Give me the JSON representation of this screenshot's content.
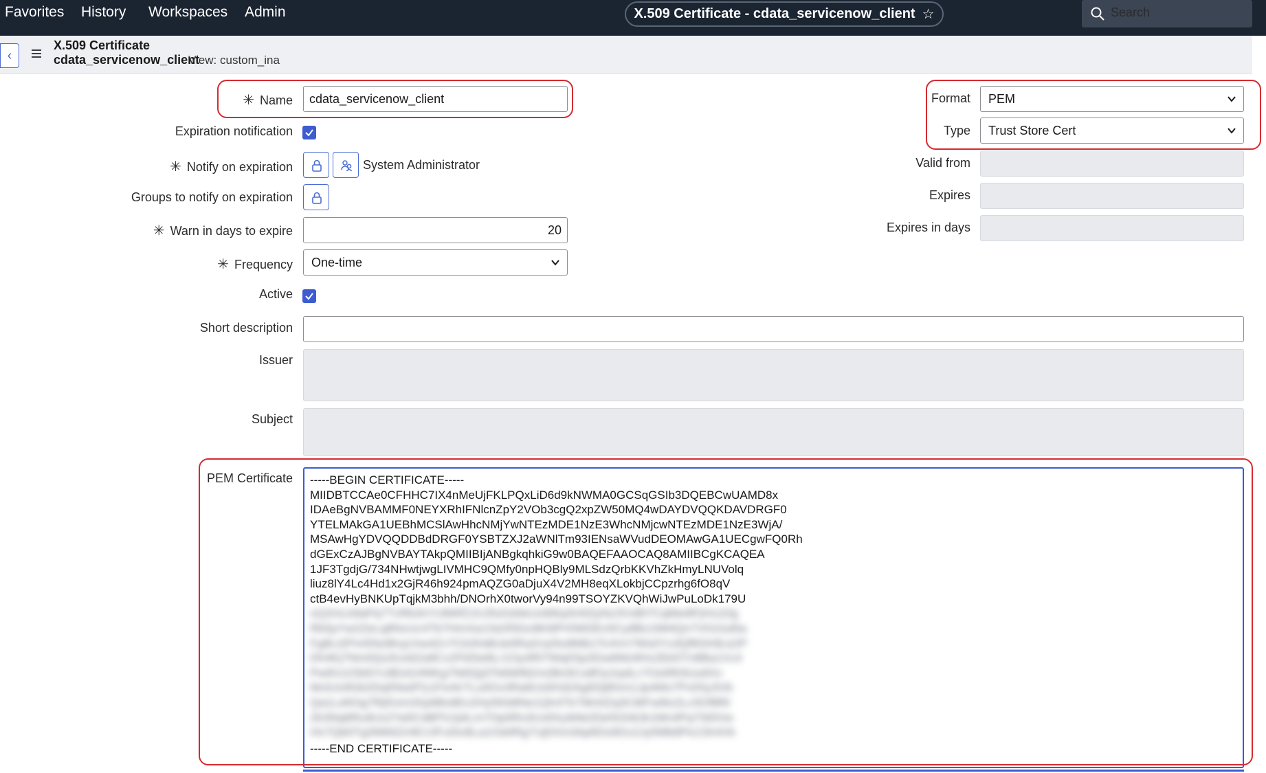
{
  "nav": {
    "items": [
      "Favorites",
      "History",
      "Workspaces",
      "Admin"
    ],
    "title": "X.509 Certificate - cdata_servicenow_client",
    "search_label": "Search"
  },
  "record": {
    "type": "X.509 Certificate",
    "name": "cdata_servicenow_client",
    "view": "View: custom_ina"
  },
  "form": {
    "name_label": "Name",
    "name_value": "cdata_servicenow_client",
    "expiration_notification_label": "Expiration notification",
    "expiration_notification_checked": true,
    "notify_on_expiration_label": "Notify on expiration",
    "notify_on_expiration_value": "System Administrator",
    "groups_to_notify_label": "Groups to notify on expiration",
    "warn_days_label": "Warn in days to expire",
    "warn_days_value": "20",
    "frequency_label": "Frequency",
    "frequency_value": "One-time",
    "active_label": "Active",
    "active_checked": true,
    "short_description_label": "Short description",
    "short_description_value": "",
    "issuer_label": "Issuer",
    "subject_label": "Subject",
    "pem_label": "PEM Certificate",
    "format_label": "Format",
    "format_value": "PEM",
    "type_label": "Type",
    "type_value": "Trust Store Cert",
    "valid_from_label": "Valid from",
    "expires_label": "Expires",
    "expires_in_days_label": "Expires in days"
  },
  "pem": {
    "lines": [
      "-----BEGIN CERTIFICATE-----",
      "MIIDBTCCAe0CFHHC7IX4nMeUjFKLPQxLiD6d9kNWMA0GCSqGSIb3DQEBCwUAMD8x",
      "IDAeBgNVBAMMF0NEYXRhIFNlcnZpY2VOb3cgQ2xpZW50MQ4wDAYDVQQKDAVDRGF0",
      "YTELMAkGA1UEBhMCSlAwHhcNMjYwNTEzMDE1NzE3WhcNMjcwNTEzMDE1NzE3WjA/",
      "MSAwHgYDVQQDDBdDRGF0YSBTZXJ2aWNlTm93IENsaWVudDEOMAwGA1UECgwFQ0Rh",
      "dGExCzAJBgNVBAYTAkpQMIIBIjANBgkqhkiG9w0BAQEFAAOCAQ8AMIIBCgKCAQEA",
      "1JF3TgdjG/734NHwtjwgLIVMHC9QMfy0npHQBly9MLSdzQrbKKVhZkHmyLNUVolq",
      "liuz8lY4Lc4Hd1x2GjR46h924pmAQZG0aDjuX4V2MH8eqXLokbjCCpzrhg6fO8qV",
      "ctB4evHyBNKUpTqjkM3bhh/DNOrhX0tworVy94n99TSOYZKVQhWiJwPuLoDk179U"
    ],
    "blurred_lines": [
      "xQ2mLk9aPq7TvRb3nYc8WfZ1hJ5sGd4eUo6iKp0rAl2yNz3VxBt7CqMw9FjHs1Dg",
      "Rk5pYw2ZeLq8NvUc4Tb7HmXa1SdJf3Go9Ki6Pr0Wl2Ex5Cy8Bz1Mt4Qn7Vh3Ju6Ia",
      "Fg8Lt2Pm5Ns9Kq1Xw4Zv7Cb3Hd6Je0Ra2Uy5Io8Mb1Tc4Vn7Ws0Yx3Qf6Gh9Lk2P",
      "Dh4Kj7Nm0Qs3Ux6Za9Cv2Fb5Ie8Lr1Oy4Rt7Wq0Sp3Gw6Mz9Hx2Ek5Tn8Ba1Vc4",
      "Pw9Vz2Sb5Yc8Ed1Hf4Kg7Ni0Qj3Tk6Wl9Zm2Bn5Co8Fp1Iq4Lr7Os0Rt3Uu6Xv",
      "Mc6Jx9Gb2Dq5Nw8Ty1Fe4Ir7Lu0Ox3Ra6Us9Xd2Ag5Dj8Gm1Jp4Ms7Pv0Sy3Vb",
      "Qa1Ld4Og7Rj0Um3Xp6Bs9Ev2Hy5Kb8Ne1Qh4Tk7Wn0Zq3Ct6Fw9Iz2Lc5Of8Ri",
      "Zk3Nq6Ru9Ux2Ya5Cd8Fh1Ij4Lm7Op0Rs3Uv6Xy9Ab2De5Gh8Jk1Mn4Pq7St0Vw",
      "Hn7Qb0Tg3Wk6Zn9Cr2Fu5Ix8La1Od4Rg7Uj0Xm3Ap6Ds9Gv2Jy5Mb8Pe1Sh4Vk"
    ],
    "end_line": "-----END CERTIFICATE-----"
  },
  "colors": {
    "nav_bg": "#1b2431",
    "accent": "#3c5ccf",
    "highlight": "#d62a2f"
  }
}
